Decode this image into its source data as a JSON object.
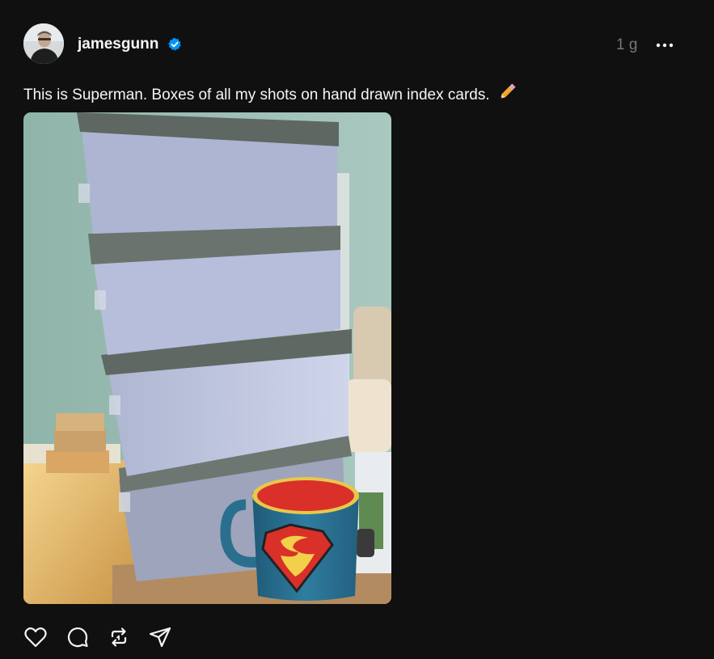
{
  "post": {
    "username": "jamesgunn",
    "verified": true,
    "time": "1 g",
    "caption": "This is Superman. Boxes of all my shots on hand drawn index cards.",
    "caption_emoji": "pencil",
    "media": {
      "description_icon": "photo",
      "colors": {
        "wall": "#9fc0b8",
        "box": "#c7cde6",
        "lid": "#6b756f",
        "mug_blue": "#2a6f8e",
        "mug_red": "#d9302a",
        "floor_light": "#f2d08a"
      }
    }
  },
  "header_icons": {
    "verified": "verified-badge-icon",
    "more": "more-options-icon"
  },
  "actions": [
    {
      "icon": "heart-icon",
      "label": "like"
    },
    {
      "icon": "comment-icon",
      "label": "comment"
    },
    {
      "icon": "repost-icon",
      "label": "repost"
    },
    {
      "icon": "share-icon",
      "label": "share"
    }
  ],
  "colors": {
    "background": "#101010",
    "text": "#f3f5f7",
    "muted": "#777777",
    "verified": "#0095f6"
  }
}
